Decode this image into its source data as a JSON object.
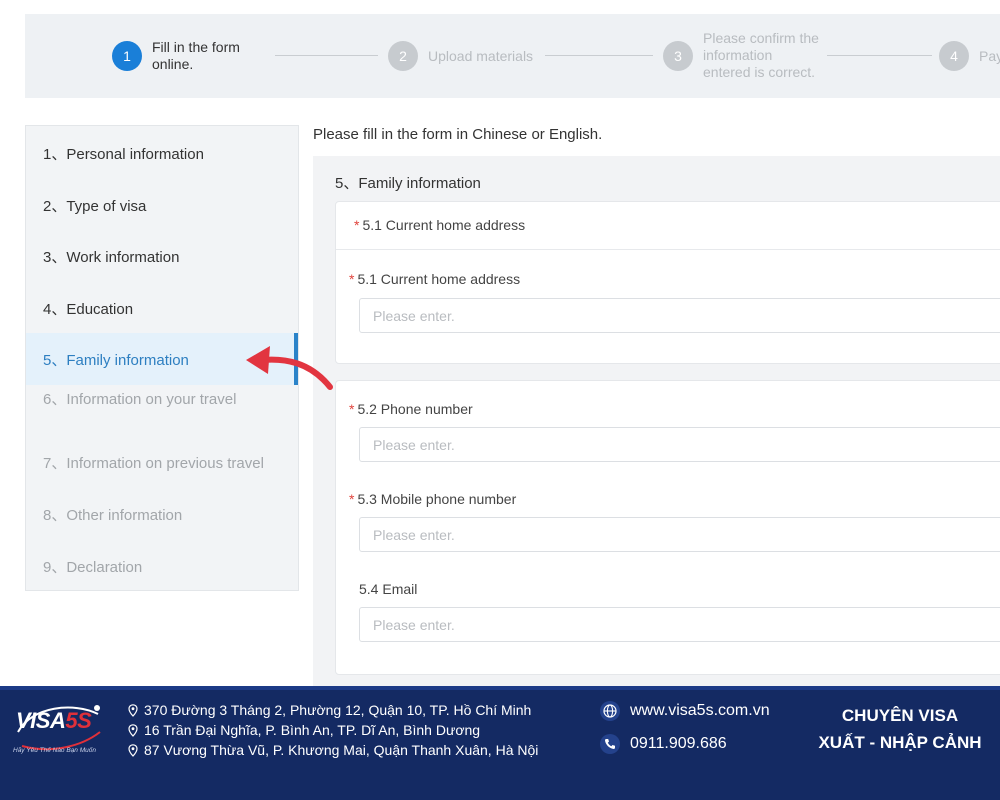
{
  "stepper": {
    "steps": [
      {
        "number": "1",
        "label_line1": "Fill in the form",
        "label_line2": "online."
      },
      {
        "number": "2",
        "label_line1": "Upload materials",
        "label_line2": ""
      },
      {
        "number": "3",
        "label_line1": "Please confirm the",
        "label_line2": "information",
        "label_line3": "entered is correct."
      },
      {
        "number": "4",
        "label_line1": "Pay",
        "label_line2": ""
      }
    ]
  },
  "sidenav": {
    "items": [
      {
        "label": "1、Personal information"
      },
      {
        "label": "2、Type of visa"
      },
      {
        "label": "3、Work information"
      },
      {
        "label": "4、Education"
      },
      {
        "label": "5、Family information"
      },
      {
        "label": "6、Information on your travel"
      },
      {
        "label": "7、Information on previous travel"
      },
      {
        "label": "8、Other information"
      },
      {
        "label": "9、Declaration"
      }
    ]
  },
  "main": {
    "hint": "Please fill in the form in Chinese or English.",
    "section_title": "5、Family information",
    "card1": {
      "header": "5.1 Current home address",
      "fields": [
        {
          "label": "5.1 Current home address",
          "required": "*",
          "placeholder": "Please enter."
        }
      ]
    },
    "card2": {
      "fields": [
        {
          "label": "5.2 Phone number",
          "required": "*",
          "placeholder": "Please enter."
        },
        {
          "label": "5.3 Mobile phone number",
          "required": "*",
          "placeholder": "Please enter."
        },
        {
          "label": "5.4 Email",
          "required": "",
          "placeholder": "Please enter."
        }
      ]
    },
    "required_mark": "*"
  },
  "footer": {
    "logo_main": "VISA",
    "logo_accent": "5S",
    "logo_tagline": "Hãy Yêu Thế Nào Bạn Muốn",
    "addresses": [
      "370 Đường 3 Tháng 2, Phường 12, Quận 10, TP. Hồ Chí Minh",
      "16 Trần Đại Nghĩa, P. Bình An, TP. Dĩ An, Bình Dương",
      "87 Vương Thừa Vũ, P. Khương Mai, Quận Thanh Xuân, Hà Nội"
    ],
    "website": "www.visa5s.com.vn",
    "phone": "0911.909.686",
    "slogan_line1": "CHUYÊN VISA",
    "slogan_line2": "XUẤT - NHẬP CẢNH"
  },
  "colors": {
    "accent": "#1a7fd8",
    "nav_active_bg": "#e4f1fb",
    "required": "#e0433b",
    "footer_bg": "#142a63",
    "arrow": "#e23540"
  }
}
